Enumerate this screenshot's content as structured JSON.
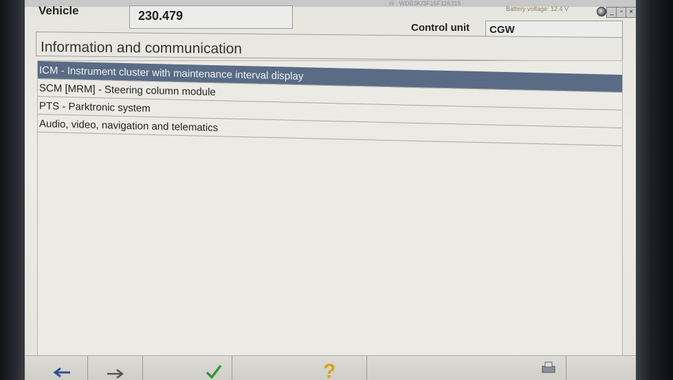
{
  "header": {
    "vin_text": "ril : WDB3K/3F16F116315",
    "battery_text": "Battery voltage: 12.4 V",
    "window_buttons": [
      "_",
      "▫",
      "×"
    ]
  },
  "vehicle": {
    "label": "Vehicle",
    "value": "230.479"
  },
  "control_unit": {
    "label": "Control unit",
    "value": "CGW"
  },
  "section": {
    "title": "Information and communication"
  },
  "list": {
    "items": [
      {
        "label": "ICM - Instrument cluster with maintenance interval display",
        "selected": true
      },
      {
        "label": "SCM [MRM] - Steering column module",
        "selected": false
      },
      {
        "label": "PTS - Parktronic system",
        "selected": false
      },
      {
        "label": "Audio, video, navigation and telematics",
        "selected": false
      }
    ]
  },
  "toolbar": {
    "icons": [
      "back-arrow-icon",
      "forward-arrow-icon",
      "check-icon",
      "help-icon",
      "print-icon"
    ]
  },
  "colors": {
    "selection": "#5a6b85",
    "screen_background": "#e8e7e1",
    "check": "#2f9a3a",
    "help": "#d6a51d"
  }
}
